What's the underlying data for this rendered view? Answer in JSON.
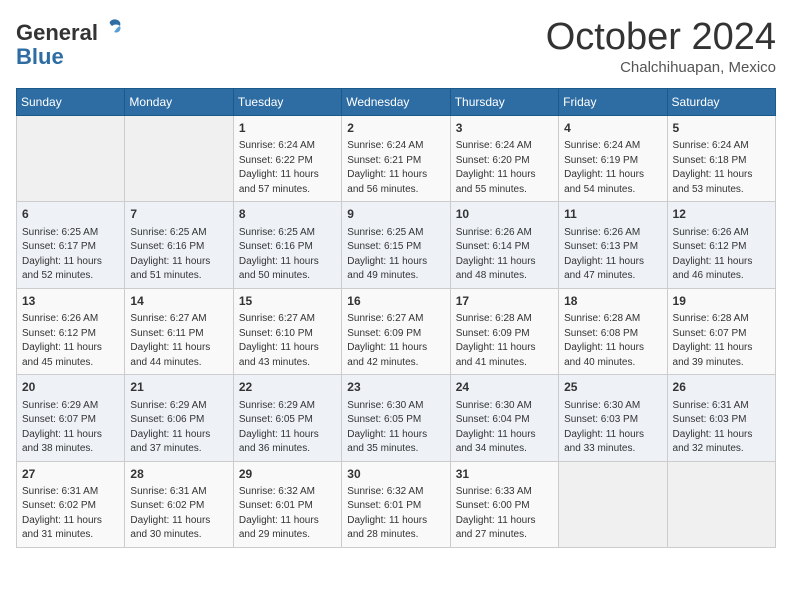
{
  "header": {
    "logo_line1": "General",
    "logo_line2": "Blue",
    "month": "October 2024",
    "location": "Chalchihuapan, Mexico"
  },
  "weekdays": [
    "Sunday",
    "Monday",
    "Tuesday",
    "Wednesday",
    "Thursday",
    "Friday",
    "Saturday"
  ],
  "weeks": [
    [
      {
        "day": "",
        "sunrise": "",
        "sunset": "",
        "daylight": ""
      },
      {
        "day": "",
        "sunrise": "",
        "sunset": "",
        "daylight": ""
      },
      {
        "day": "1",
        "sunrise": "Sunrise: 6:24 AM",
        "sunset": "Sunset: 6:22 PM",
        "daylight": "Daylight: 11 hours and 57 minutes."
      },
      {
        "day": "2",
        "sunrise": "Sunrise: 6:24 AM",
        "sunset": "Sunset: 6:21 PM",
        "daylight": "Daylight: 11 hours and 56 minutes."
      },
      {
        "day": "3",
        "sunrise": "Sunrise: 6:24 AM",
        "sunset": "Sunset: 6:20 PM",
        "daylight": "Daylight: 11 hours and 55 minutes."
      },
      {
        "day": "4",
        "sunrise": "Sunrise: 6:24 AM",
        "sunset": "Sunset: 6:19 PM",
        "daylight": "Daylight: 11 hours and 54 minutes."
      },
      {
        "day": "5",
        "sunrise": "Sunrise: 6:24 AM",
        "sunset": "Sunset: 6:18 PM",
        "daylight": "Daylight: 11 hours and 53 minutes."
      }
    ],
    [
      {
        "day": "6",
        "sunrise": "Sunrise: 6:25 AM",
        "sunset": "Sunset: 6:17 PM",
        "daylight": "Daylight: 11 hours and 52 minutes."
      },
      {
        "day": "7",
        "sunrise": "Sunrise: 6:25 AM",
        "sunset": "Sunset: 6:16 PM",
        "daylight": "Daylight: 11 hours and 51 minutes."
      },
      {
        "day": "8",
        "sunrise": "Sunrise: 6:25 AM",
        "sunset": "Sunset: 6:16 PM",
        "daylight": "Daylight: 11 hours and 50 minutes."
      },
      {
        "day": "9",
        "sunrise": "Sunrise: 6:25 AM",
        "sunset": "Sunset: 6:15 PM",
        "daylight": "Daylight: 11 hours and 49 minutes."
      },
      {
        "day": "10",
        "sunrise": "Sunrise: 6:26 AM",
        "sunset": "Sunset: 6:14 PM",
        "daylight": "Daylight: 11 hours and 48 minutes."
      },
      {
        "day": "11",
        "sunrise": "Sunrise: 6:26 AM",
        "sunset": "Sunset: 6:13 PM",
        "daylight": "Daylight: 11 hours and 47 minutes."
      },
      {
        "day": "12",
        "sunrise": "Sunrise: 6:26 AM",
        "sunset": "Sunset: 6:12 PM",
        "daylight": "Daylight: 11 hours and 46 minutes."
      }
    ],
    [
      {
        "day": "13",
        "sunrise": "Sunrise: 6:26 AM",
        "sunset": "Sunset: 6:12 PM",
        "daylight": "Daylight: 11 hours and 45 minutes."
      },
      {
        "day": "14",
        "sunrise": "Sunrise: 6:27 AM",
        "sunset": "Sunset: 6:11 PM",
        "daylight": "Daylight: 11 hours and 44 minutes."
      },
      {
        "day": "15",
        "sunrise": "Sunrise: 6:27 AM",
        "sunset": "Sunset: 6:10 PM",
        "daylight": "Daylight: 11 hours and 43 minutes."
      },
      {
        "day": "16",
        "sunrise": "Sunrise: 6:27 AM",
        "sunset": "Sunset: 6:09 PM",
        "daylight": "Daylight: 11 hours and 42 minutes."
      },
      {
        "day": "17",
        "sunrise": "Sunrise: 6:28 AM",
        "sunset": "Sunset: 6:09 PM",
        "daylight": "Daylight: 11 hours and 41 minutes."
      },
      {
        "day": "18",
        "sunrise": "Sunrise: 6:28 AM",
        "sunset": "Sunset: 6:08 PM",
        "daylight": "Daylight: 11 hours and 40 minutes."
      },
      {
        "day": "19",
        "sunrise": "Sunrise: 6:28 AM",
        "sunset": "Sunset: 6:07 PM",
        "daylight": "Daylight: 11 hours and 39 minutes."
      }
    ],
    [
      {
        "day": "20",
        "sunrise": "Sunrise: 6:29 AM",
        "sunset": "Sunset: 6:07 PM",
        "daylight": "Daylight: 11 hours and 38 minutes."
      },
      {
        "day": "21",
        "sunrise": "Sunrise: 6:29 AM",
        "sunset": "Sunset: 6:06 PM",
        "daylight": "Daylight: 11 hours and 37 minutes."
      },
      {
        "day": "22",
        "sunrise": "Sunrise: 6:29 AM",
        "sunset": "Sunset: 6:05 PM",
        "daylight": "Daylight: 11 hours and 36 minutes."
      },
      {
        "day": "23",
        "sunrise": "Sunrise: 6:30 AM",
        "sunset": "Sunset: 6:05 PM",
        "daylight": "Daylight: 11 hours and 35 minutes."
      },
      {
        "day": "24",
        "sunrise": "Sunrise: 6:30 AM",
        "sunset": "Sunset: 6:04 PM",
        "daylight": "Daylight: 11 hours and 34 minutes."
      },
      {
        "day": "25",
        "sunrise": "Sunrise: 6:30 AM",
        "sunset": "Sunset: 6:03 PM",
        "daylight": "Daylight: 11 hours and 33 minutes."
      },
      {
        "day": "26",
        "sunrise": "Sunrise: 6:31 AM",
        "sunset": "Sunset: 6:03 PM",
        "daylight": "Daylight: 11 hours and 32 minutes."
      }
    ],
    [
      {
        "day": "27",
        "sunrise": "Sunrise: 6:31 AM",
        "sunset": "Sunset: 6:02 PM",
        "daylight": "Daylight: 11 hours and 31 minutes."
      },
      {
        "day": "28",
        "sunrise": "Sunrise: 6:31 AM",
        "sunset": "Sunset: 6:02 PM",
        "daylight": "Daylight: 11 hours and 30 minutes."
      },
      {
        "day": "29",
        "sunrise": "Sunrise: 6:32 AM",
        "sunset": "Sunset: 6:01 PM",
        "daylight": "Daylight: 11 hours and 29 minutes."
      },
      {
        "day": "30",
        "sunrise": "Sunrise: 6:32 AM",
        "sunset": "Sunset: 6:01 PM",
        "daylight": "Daylight: 11 hours and 28 minutes."
      },
      {
        "day": "31",
        "sunrise": "Sunrise: 6:33 AM",
        "sunset": "Sunset: 6:00 PM",
        "daylight": "Daylight: 11 hours and 27 minutes."
      },
      {
        "day": "",
        "sunrise": "",
        "sunset": "",
        "daylight": ""
      },
      {
        "day": "",
        "sunrise": "",
        "sunset": "",
        "daylight": ""
      }
    ]
  ]
}
